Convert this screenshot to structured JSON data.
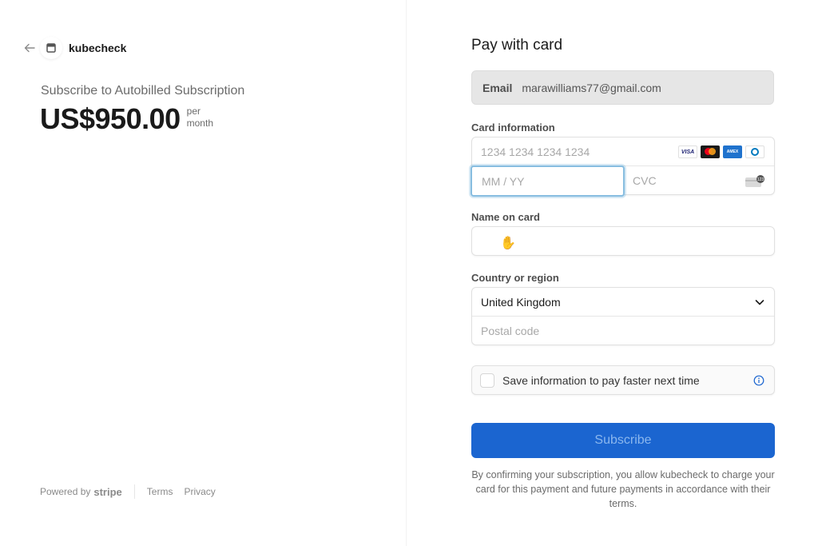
{
  "merchant": {
    "name": "kubecheck",
    "back_icon": "arrow-left-icon",
    "logo_icon": "store-icon"
  },
  "product": {
    "name": "Subscribe to Autobilled Subscription",
    "price": "US$950.00",
    "period_line1": "per",
    "period_line2": "month"
  },
  "footer": {
    "powered_by": "Powered by",
    "brand": "stripe",
    "terms": "Terms",
    "privacy": "Privacy"
  },
  "form": {
    "title": "Pay with card",
    "email": {
      "label": "Email",
      "value": "marawilliams77@gmail.com"
    },
    "card": {
      "label": "Card information",
      "number_placeholder": "1234 1234 1234 1234",
      "expiry_placeholder": "MM / YY",
      "cvc_placeholder": "CVC",
      "brands": [
        "VISA",
        "Mastercard",
        "American Express",
        "Diners Club"
      ]
    },
    "name": {
      "label": "Name on card",
      "value": ""
    },
    "country": {
      "label": "Country or region",
      "selected": "United Kingdom",
      "postal_placeholder": "Postal code"
    },
    "save_info": {
      "label": "Save information to pay faster next time",
      "checked": false
    },
    "submit_label": "Subscribe",
    "terms_text": "By confirming your subscription, you allow kubecheck to charge your card for this payment and future payments in accordance with their terms."
  },
  "colors": {
    "accent": "#1b65d0",
    "focus_ring": "#87bde0"
  }
}
